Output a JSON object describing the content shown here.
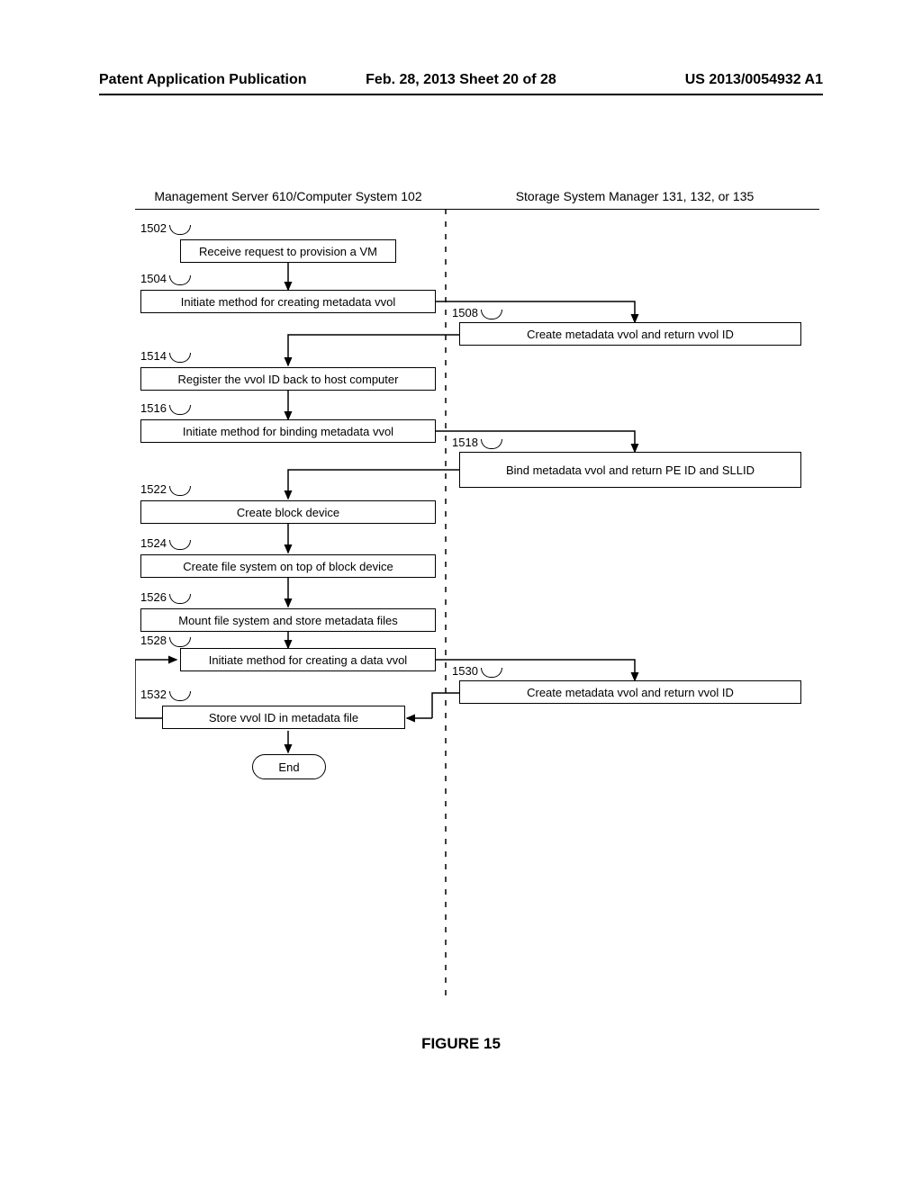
{
  "header": {
    "left": "Patent Application Publication",
    "mid": "Feb. 28, 2013  Sheet 20 of 28",
    "right": "US 2013/0054932 A1"
  },
  "columns": {
    "left": "Management Server 610/Computer System 102",
    "right": "Storage System Manager 131, 132, or 135"
  },
  "refs": {
    "r1502": "1502",
    "r1504": "1504",
    "r1508": "1508",
    "r1514": "1514",
    "r1516": "1516",
    "r1518": "1518",
    "r1522": "1522",
    "r1524": "1524",
    "r1526": "1526",
    "r1528": "1528",
    "r1530": "1530",
    "r1532": "1532"
  },
  "steps": {
    "s1502": "Receive request to provision a VM",
    "s1504": "Initiate method for creating metadata vvol",
    "s1508": "Create metadata vvol and return vvol ID",
    "s1514": "Register the vvol ID back to host computer",
    "s1516": "Initiate method for binding metadata vvol",
    "s1518": "Bind metadata vvol and return PE ID and SLLID",
    "s1522": "Create block device",
    "s1524": "Create file system on top of block device",
    "s1526": "Mount file system and store metadata files",
    "s1528": "Initiate method for creating a data vvol",
    "s1530": "Create metadata vvol and return vvol ID",
    "s1532": "Store vvol ID in metadata file",
    "end": "End"
  },
  "figure_caption": "FIGURE 15"
}
